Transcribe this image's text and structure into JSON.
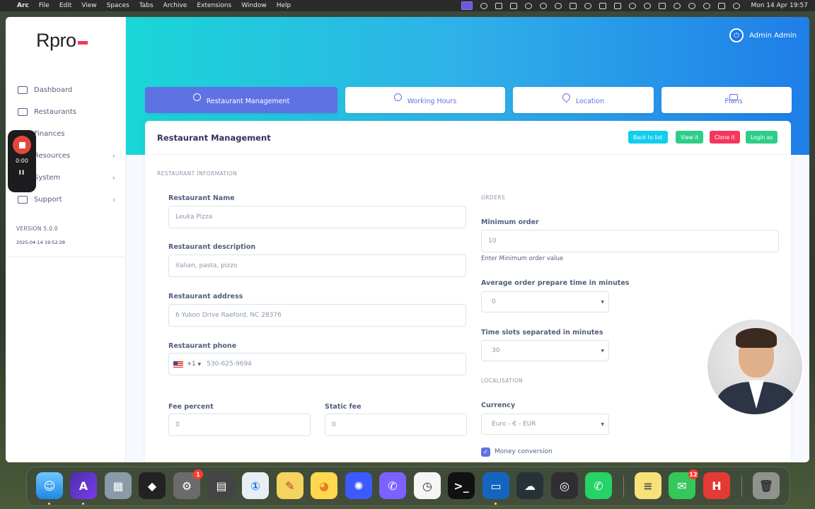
{
  "menubar": {
    "app": "Arc",
    "items": [
      "File",
      "Edit",
      "View",
      "Spaces",
      "Tabs",
      "Archive",
      "Extensions",
      "Window",
      "Help"
    ],
    "datetime": "Mon 14 Apr  19:57"
  },
  "sidebar": {
    "logo": "Rpro",
    "items": [
      {
        "label": "Dashboard",
        "icon": "monitor-icon"
      },
      {
        "label": "Restaurants",
        "icon": "store-icon"
      },
      {
        "label": "Finances",
        "icon": "money-icon"
      },
      {
        "label": "Resources",
        "icon": "folder-icon",
        "chevron": "›"
      },
      {
        "label": "System",
        "icon": "gear-icon",
        "chevron": "›"
      },
      {
        "label": "Support",
        "icon": "support-icon",
        "chevron": "›"
      }
    ],
    "version": "VERSION 5.0.0",
    "build": "2025-04-14 19:52:28"
  },
  "recorder": {
    "time": "0:00",
    "pause": "II"
  },
  "header": {
    "user": "Admin Admin"
  },
  "tabs": [
    {
      "label": "Restaurant Management",
      "active": true
    },
    {
      "label": "Working Hours",
      "active": false
    },
    {
      "label": "Location",
      "active": false
    },
    {
      "label": "Plans",
      "active": false
    }
  ],
  "card": {
    "title": "Restaurant Management",
    "buttons": {
      "back": "Back to list",
      "view": "View it",
      "clone": "Clone it",
      "login": "Login as"
    }
  },
  "restaurant_info": {
    "section": "RESTAURANT INFORMATION",
    "name_label": "Restaurant Name",
    "name_value": "Leuka Pizza",
    "description_label": "Restaurant description",
    "description_value": "italian, pasta, pizzo",
    "address_label": "Restaurant address",
    "address_value": "6 Yukon Drive Raeford, NC 28376",
    "phone_label": "Restaurant phone",
    "phone_prefix": "+1",
    "phone_value": "530-625-9694",
    "fee_percent_label": "Fee percent",
    "fee_percent_value": "0",
    "static_fee_label": "Static fee",
    "static_fee_value": "0"
  },
  "orders": {
    "section": "ORDERS",
    "min_order_label": "Minimum order",
    "min_order_value": "10",
    "min_order_help": "Enter Minimum order value",
    "prep_time_label": "Average order prepare time in minutes",
    "prep_time_value": "0",
    "time_slots_label": "Time slots separated in minutes",
    "time_slots_value": "30"
  },
  "localisation": {
    "section": "LOCALISATION",
    "currency_label": "Currency",
    "currency_value": "Euro - € - EUR",
    "money_conversion_label": "Money conversion",
    "money_conversion_checked": true
  },
  "dock": {
    "badges": {
      "settings": "1",
      "messages": "12"
    }
  },
  "colors": {
    "primary": "#5e72e4",
    "info": "#11cdef",
    "success": "#2dce89",
    "danger": "#f5365c"
  }
}
